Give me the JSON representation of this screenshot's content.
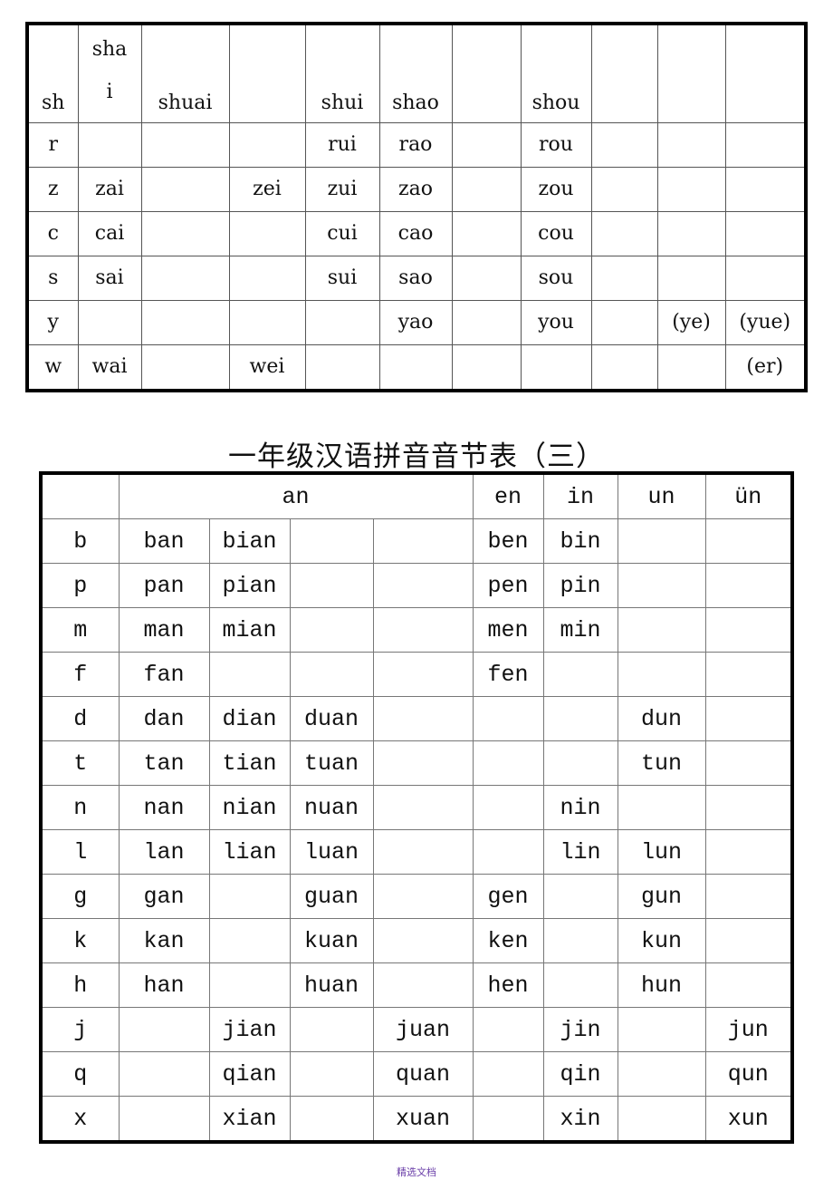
{
  "table1": {
    "first_row": [
      "sh",
      "sha|i",
      "shuai",
      "",
      "shui",
      "shao",
      "",
      "shou",
      "",
      "",
      ""
    ],
    "rows": [
      [
        "r",
        "",
        "",
        "",
        "rui",
        "rao",
        "",
        "rou",
        "",
        "",
        ""
      ],
      [
        "z",
        "zai",
        "",
        "zei",
        "zui",
        "zao",
        "",
        "zou",
        "",
        "",
        ""
      ],
      [
        "c",
        "cai",
        "",
        "",
        "cui",
        "cao",
        "",
        "cou",
        "",
        "",
        ""
      ],
      [
        "s",
        "sai",
        "",
        "",
        "sui",
        "sao",
        "",
        "sou",
        "",
        "",
        ""
      ],
      [
        "y",
        "",
        "",
        "",
        "",
        "yao",
        "",
        "you",
        "",
        "(ye)",
        "(yue)"
      ],
      [
        "w",
        "wai",
        "",
        "wei",
        "",
        "",
        "",
        "",
        "",
        "",
        "(er)"
      ]
    ]
  },
  "title2": "一年级汉语拼音音节表（三）",
  "table2": {
    "header": {
      "corner": "",
      "an": "an",
      "en": "en",
      "in": "in",
      "un": "un",
      "vn": "ün"
    },
    "rows": [
      [
        "b",
        "ban",
        "bian",
        "",
        "",
        "ben",
        "bin",
        "",
        ""
      ],
      [
        "p",
        "pan",
        "pian",
        "",
        "",
        "pen",
        "pin",
        "",
        ""
      ],
      [
        "m",
        "man",
        "mian",
        "",
        "",
        "men",
        "min",
        "",
        ""
      ],
      [
        "f",
        "fan",
        "",
        "",
        "",
        "fen",
        "",
        "",
        ""
      ],
      [
        "d",
        "dan",
        "dian",
        "duan",
        "",
        "",
        "",
        "dun",
        ""
      ],
      [
        "t",
        "tan",
        "tian",
        "tuan",
        "",
        "",
        "",
        "tun",
        ""
      ],
      [
        "n",
        "nan",
        "nian",
        "nuan",
        "",
        "",
        "nin",
        "",
        ""
      ],
      [
        "l",
        "lan",
        "lian",
        "luan",
        "",
        "",
        "lin",
        "lun",
        ""
      ],
      [
        "g",
        "gan",
        "",
        "guan",
        "",
        "gen",
        "",
        "gun",
        ""
      ],
      [
        "k",
        "kan",
        "",
        "kuan",
        "",
        "ken",
        "",
        "kun",
        ""
      ],
      [
        "h",
        "han",
        "",
        "huan",
        "",
        "hen",
        "",
        "hun",
        ""
      ],
      [
        "j",
        "",
        "jian",
        "",
        "juan",
        "",
        "jin",
        "",
        "jun"
      ],
      [
        "q",
        "",
        "qian",
        "",
        "quan",
        "",
        "qin",
        "",
        "qun"
      ],
      [
        "x",
        "",
        "xian",
        "",
        "xuan",
        "",
        "xin",
        "",
        "xun"
      ]
    ]
  },
  "footer": "精选文档"
}
